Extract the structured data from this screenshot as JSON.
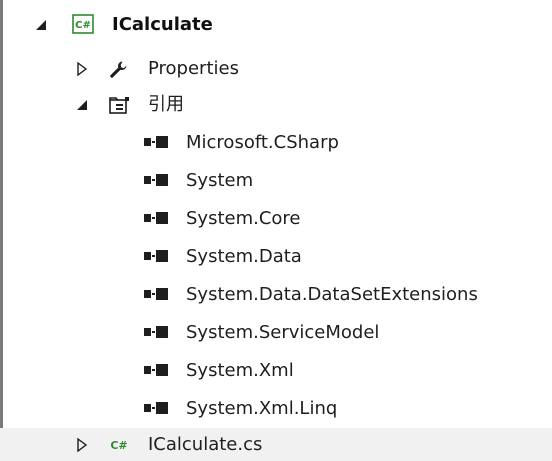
{
  "project": {
    "name": "ICalculate",
    "icon": "csharp-project-icon",
    "expanded": true,
    "children": {
      "properties": {
        "label": "Properties",
        "icon": "wrench-icon",
        "expanded": false
      },
      "references": {
        "label": "引用",
        "icon": "references-folder-icon",
        "expanded": true,
        "items": [
          "Microsoft.CSharp",
          "System",
          "System.Core",
          "System.Data",
          "System.Data.DataSetExtensions",
          "System.ServiceModel",
          "System.Xml",
          "System.Xml.Linq"
        ]
      },
      "file": {
        "label": "ICalculate.cs",
        "icon": "csharp-file-icon",
        "expanded": false
      }
    }
  },
  "colors": {
    "csharp_green": "#2f8a2f",
    "text": "#1e1e1e",
    "selection_row": "#f1f1f1"
  }
}
